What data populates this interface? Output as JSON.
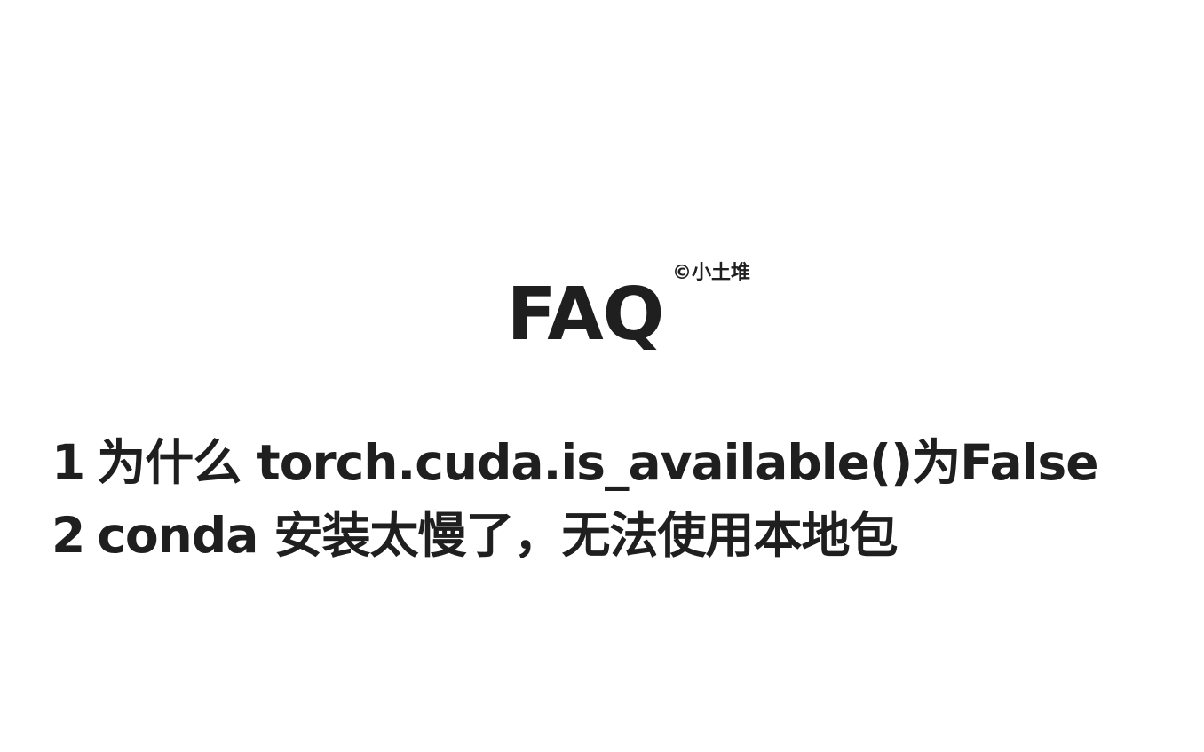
{
  "title": "FAQ",
  "watermark": "©小土堆",
  "faq": [
    {
      "number": "1",
      "text": "为什么 torch.cuda.is_available()为False"
    },
    {
      "number": "2",
      "text": "conda 安装太慢了，无法使用本地包"
    }
  ],
  "colors": {
    "background": "#ffffff",
    "text": "#1f1f1f"
  }
}
